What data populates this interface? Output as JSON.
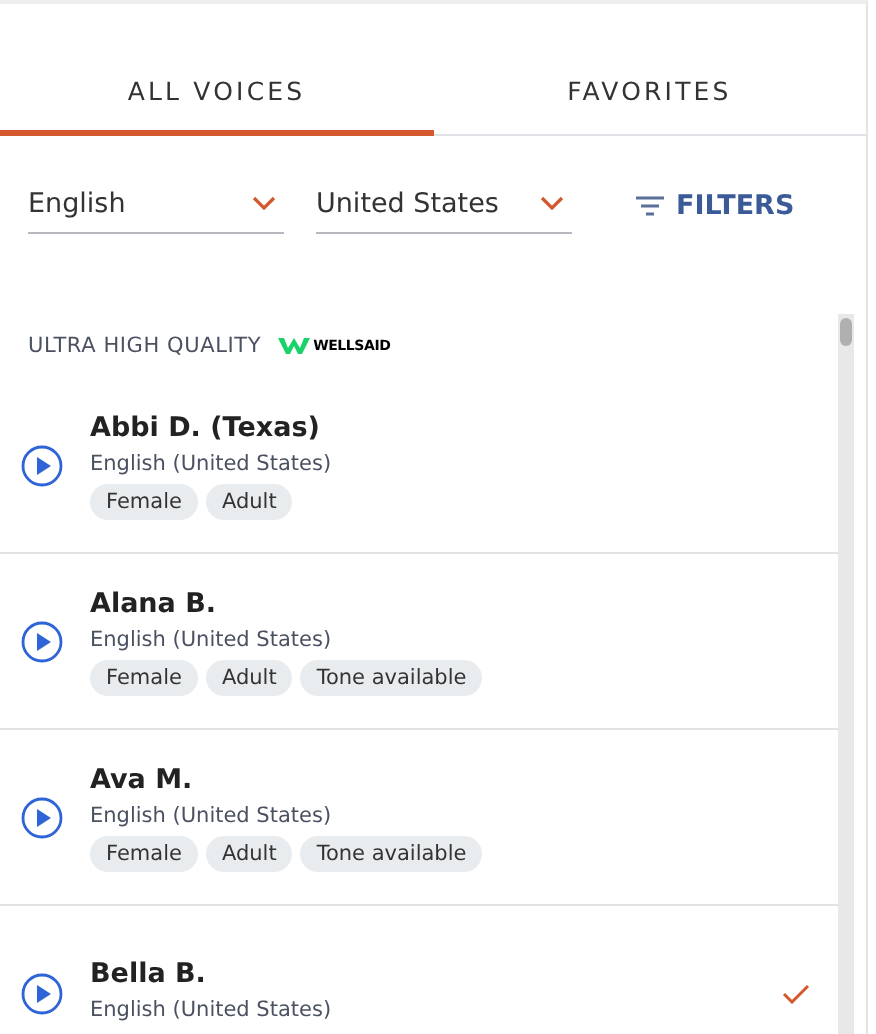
{
  "tabs": [
    {
      "label": "ALL VOICES",
      "selected": true
    },
    {
      "label": "FAVORITES",
      "selected": false
    }
  ],
  "filters": {
    "language": "English",
    "region": "United States",
    "button": "FILTERS"
  },
  "section": {
    "title": "ULTRA HIGH QUALITY",
    "brand": "WELLSAID"
  },
  "voices": [
    {
      "name": "Abbi D. (Texas)",
      "language": "English (United States)",
      "tags": [
        "Female",
        "Adult"
      ],
      "selected": false
    },
    {
      "name": "Alana B.",
      "language": "English (United States)",
      "tags": [
        "Female",
        "Adult",
        "Tone available"
      ],
      "selected": false
    },
    {
      "name": "Ava M.",
      "language": "English (United States)",
      "tags": [
        "Female",
        "Adult",
        "Tone available"
      ],
      "selected": false
    },
    {
      "name": "Bella B.",
      "language": "English (United States)",
      "selected": true
    }
  ]
}
